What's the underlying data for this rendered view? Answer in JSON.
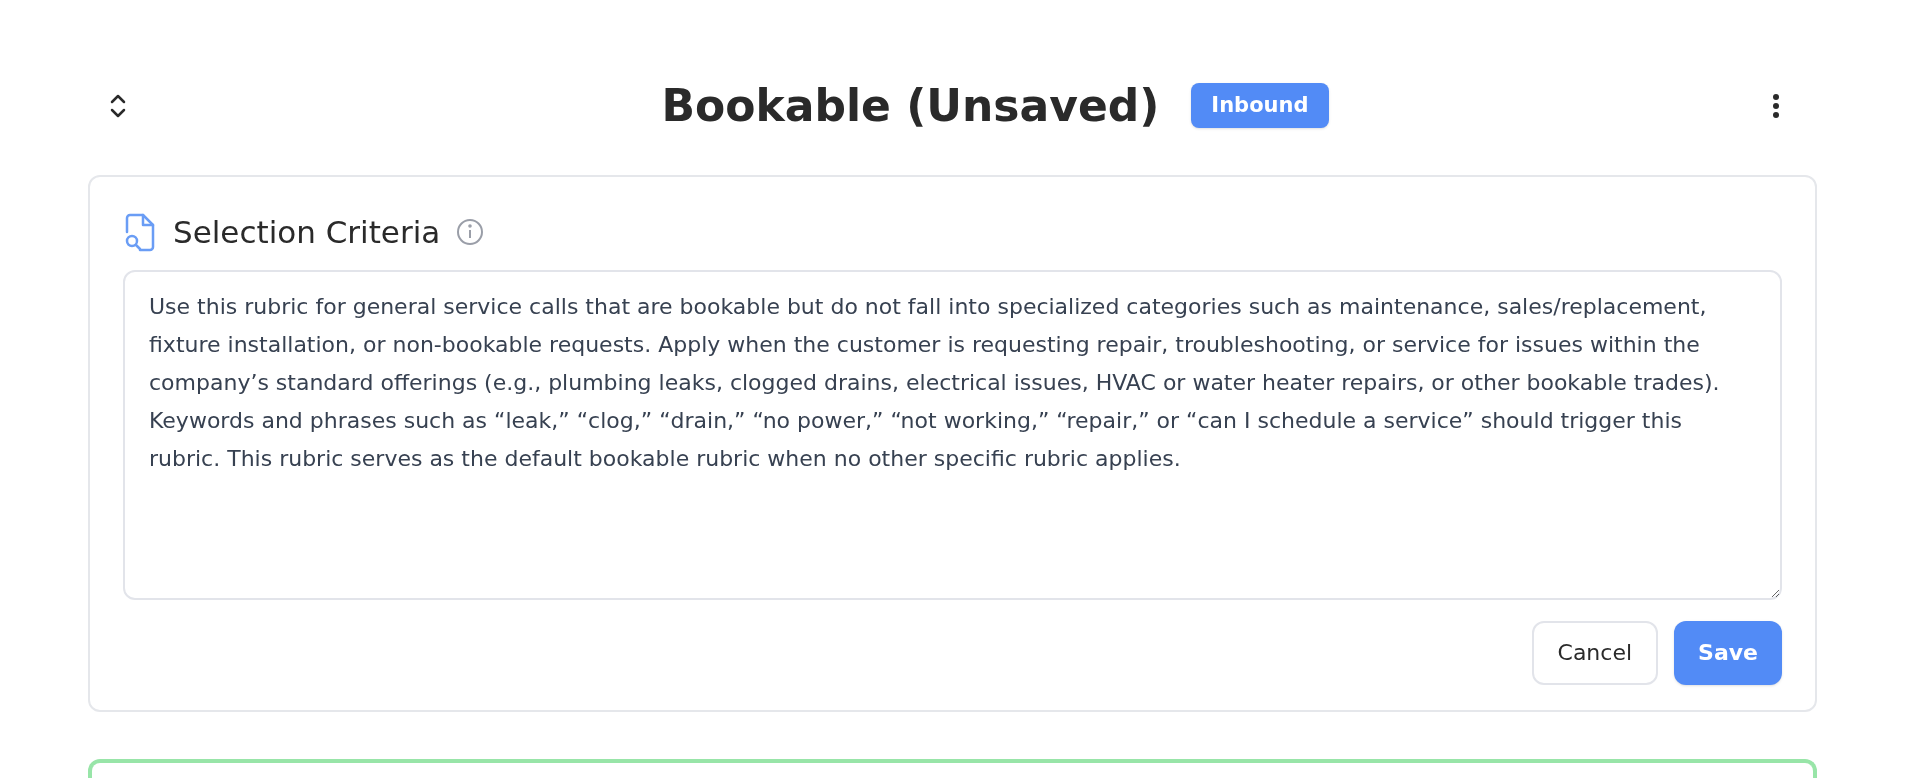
{
  "header": {
    "title": "Bookable (Unsaved)",
    "badge": "Inbound"
  },
  "selection_criteria": {
    "title": "Selection Criteria",
    "value": "Use this rubric for general service calls that are bookable but do not fall into specialized categories such as maintenance, sales/replacement, fixture installation, or non-bookable requests. Apply when the customer is requesting repair, troubleshooting, or service for issues within the company’s standard offerings (e.g., plumbing leaks, clogged drains, electrical issues, HVAC or water heater repairs, or other bookable trades). Keywords and phrases such as “leak,” “clog,” “drain,” “no power,” “not working,” “repair,” or “can I schedule a service” should trigger this rubric. This rubric serves as the default bookable rubric when no other specific rubric applies.",
    "buttons": [
      {
        "label": "Cancel",
        "kind": "secondary"
      },
      {
        "label": "Save",
        "kind": "primary"
      }
    ]
  }
}
